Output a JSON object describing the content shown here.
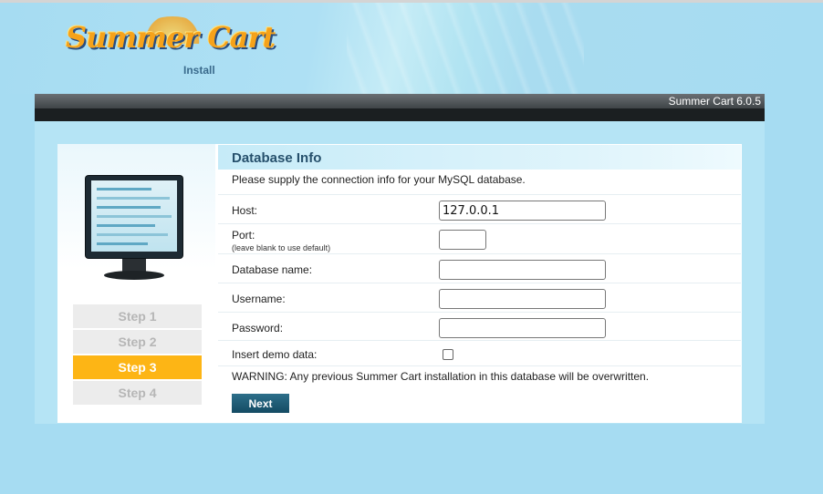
{
  "header": {
    "logo_text": "Summer Cart",
    "logo_subtitle": "Install",
    "version": "Summer Cart 6.0.5"
  },
  "steps": [
    {
      "label": "Step 1",
      "active": false
    },
    {
      "label": "Step 2",
      "active": false
    },
    {
      "label": "Step 3",
      "active": true
    },
    {
      "label": "Step 4",
      "active": false
    }
  ],
  "form": {
    "title": "Database Info",
    "intro": "Please supply the connection info for your MySQL database.",
    "host_label": "Host:",
    "host_value": "127.0.0.1",
    "port_label": "Port:",
    "port_hint": "(leave blank to use default)",
    "port_value": "",
    "dbname_label": "Database name:",
    "dbname_value": "",
    "username_label": "Username:",
    "username_value": "",
    "password_label": "Password:",
    "password_value": "",
    "demo_label": "Insert demo data:",
    "demo_checked": false,
    "warning": "WARNING: Any previous Summer Cart installation in this database will be overwritten.",
    "next_label": "Next"
  },
  "colors": {
    "background": "#a6dcf2",
    "active_step": "#fdb515",
    "inactive_step": "#ececec",
    "title": "#26506c",
    "button": "#144b63"
  }
}
